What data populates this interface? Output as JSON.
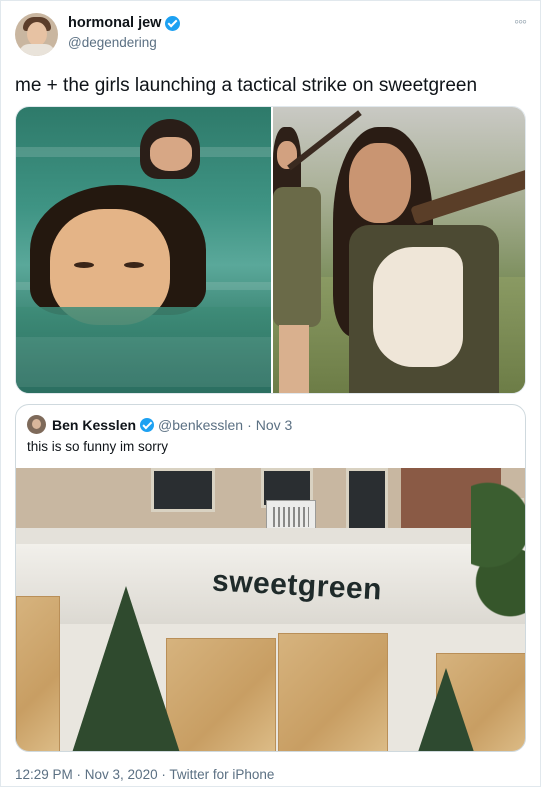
{
  "author": {
    "display_name": "hormonal jew",
    "handle": "@degendering",
    "verified": true
  },
  "menu_icon": "more-options-icon",
  "more_label": "◦◦◦",
  "tweet_text": "me + the girls launching a tactical strike on sweetgreen",
  "quoted_tweet": {
    "display_name": "Ben Kesslen",
    "handle": "@benkesslen",
    "separator": "·",
    "date": "Nov 3",
    "verified": true,
    "text": "this is so funny im sorry",
    "photo_sign_text": "sweetgreen"
  },
  "footer": {
    "timestamp": "12:29 PM · Nov 3, 2020 · Twitter for iPhone"
  },
  "colors": {
    "verified_badge": "#1da1f2",
    "secondary_text": "#5b7083",
    "border": "#cfd9de"
  }
}
